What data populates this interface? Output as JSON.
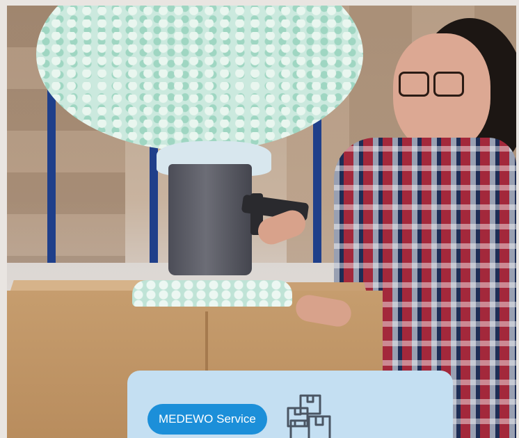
{
  "card": {
    "service_label": "MEDEWO Service",
    "icon": "boxes-icon"
  },
  "colors": {
    "card_background": "#c4dff2",
    "pill_background": "#1c8fd9",
    "pill_text": "#ffffff",
    "icon_stroke": "#4a5563"
  }
}
